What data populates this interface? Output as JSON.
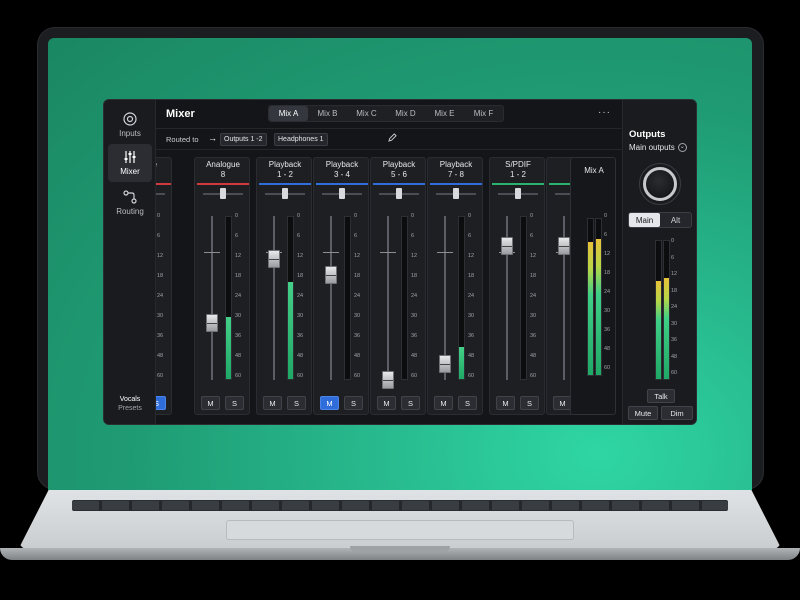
{
  "app": {
    "title": "Mixer",
    "more_label": "···"
  },
  "sidebar": {
    "items": [
      {
        "label": "Inputs",
        "icon": "inputs-icon"
      },
      {
        "label": "Mixer",
        "icon": "mixer-sliders-icon",
        "active": true
      },
      {
        "label": "Routing",
        "icon": "routing-icon"
      }
    ],
    "presets_name": "Vocals",
    "presets_label": "Presets"
  },
  "tabs": [
    "Mix A",
    "Mix B",
    "Mix C",
    "Mix D",
    "Mix E",
    "Mix F"
  ],
  "active_tab": "Mix A",
  "routing": {
    "label": "Routed to",
    "arrow": "→",
    "destinations": [
      "Outputs 1 -2",
      "Headphones 1"
    ],
    "edit_icon": "pencil-icon"
  },
  "scale_ticks": [
    "0",
    "6",
    "12",
    "18",
    "24",
    "30",
    "36",
    "48",
    "60"
  ],
  "channels": [
    {
      "line1": "alogue",
      "line2": "7",
      "color": "#d13a3a",
      "fader": 0.15,
      "meter": 0.0,
      "mute": false,
      "solo": false,
      "solo_on": true,
      "partial": true
    },
    {
      "line1": "Analogue",
      "line2": "8",
      "color": "#d13a3a",
      "fader": 0.35,
      "meter": 0.38,
      "mute_label": "M",
      "solo_label": "S"
    },
    {
      "line1": "Playback",
      "line2": "1 - 2",
      "color": "#2f6ddb",
      "fader": 0.74,
      "meter": 0.6,
      "mute_label": "M",
      "solo_label": "S"
    },
    {
      "line1": "Playback",
      "line2": "3 - 4",
      "color": "#2f6ddb",
      "fader": 0.64,
      "meter": 0.0,
      "mute_label": "M",
      "solo_label": "S",
      "mute_on": true
    },
    {
      "line1": "Playback",
      "line2": "5 - 6",
      "color": "#2f6ddb",
      "fader": 0.0,
      "meter": 0.0,
      "mute_label": "M",
      "solo_label": "S"
    },
    {
      "line1": "Playback",
      "line2": "7 - 8",
      "color": "#2f6ddb",
      "fader": 0.1,
      "meter": 0.2,
      "mute_label": "M",
      "solo_label": "S"
    },
    {
      "line1": "S/PDIF",
      "line2": "1 - 2",
      "color": "#2bb36b",
      "fader": 0.82,
      "meter": 0.0,
      "mute_label": "M",
      "solo_label": "S"
    },
    {
      "line1": "A",
      "line2": "",
      "color": "#2bb36b",
      "fader": 0.82,
      "meter": 0.0,
      "mute_label": "M",
      "solo_label": "",
      "partial_right": true
    }
  ],
  "mix_column": {
    "label": "Mix A",
    "meter_left": 0.85,
    "meter_right": 0.87
  },
  "outputs": {
    "title": "Outputs",
    "selector": "Main outputs",
    "chevron": "⌄",
    "main_label": "Main",
    "alt_label": "Alt",
    "active": "Main",
    "meter_left": 0.71,
    "meter_right": 0.73,
    "talk_label": "Talk",
    "mute_label": "Mute",
    "dim_label": "Dim"
  },
  "colors": {
    "accent_blue": "#2f6ddb",
    "meter_green": "#1fa866",
    "screen_bg": "#25b487"
  }
}
